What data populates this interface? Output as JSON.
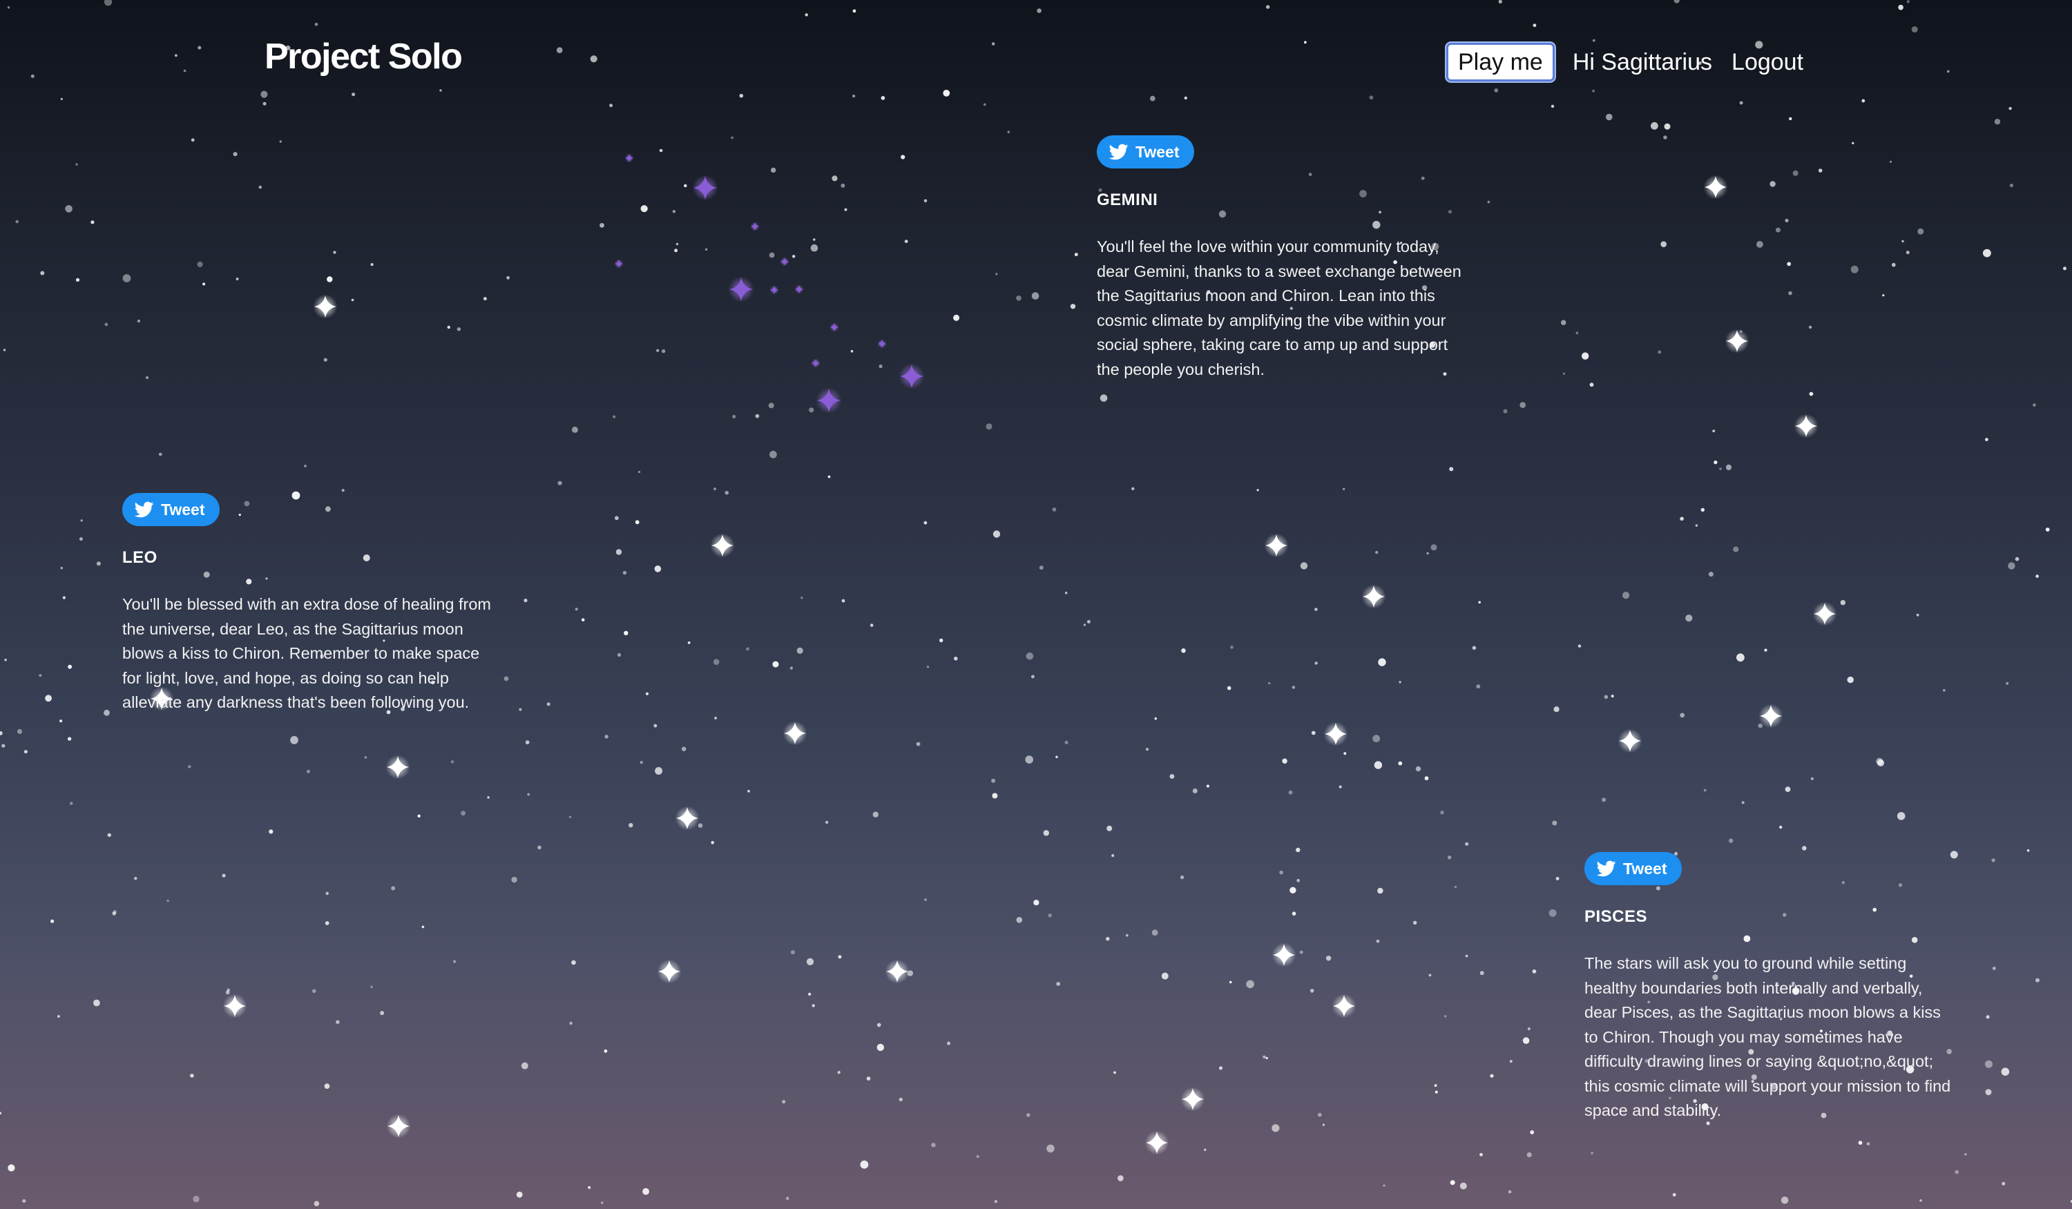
{
  "header": {
    "brand": "Project Solo",
    "play_label": "Play me",
    "greeting": "Hi Sagittarius",
    "logout_label": "Logout"
  },
  "cards": [
    {
      "tweet_label": "Tweet",
      "sign": "GEMINI",
      "text": "You'll feel the love within your community today, dear Gemini, thanks to a sweet exchange between the Sagittarius moon and Chiron. Lean into this cosmic climate by amplifying the vibe within your social sphere, taking care to amp up and support the people you cherish."
    },
    {
      "tweet_label": "Tweet",
      "sign": "LEO",
      "text": "You'll be blessed with an extra dose of healing from the universe, dear Leo, as the Sagittarius moon blows a kiss to Chiron. Remember to make space for light, love, and hope, as doing so can help alleviate any darkness that's been following you."
    },
    {
      "tweet_label": "Tweet",
      "sign": "PISCES",
      "text": "The stars will ask you to ground while setting healthy boundaries both internally and verbally, dear Pisces, as the Sagittarius moon blows a kiss to Chiron. Though you may sometimes have difficulty drawing lines or saying &quot;no,&quot; this cosmic climate will support your mission to find space and stability."
    }
  ],
  "icons": {
    "tweet": "twitter-bird-icon",
    "sparkle": "sparkle-star-icon"
  },
  "colors": {
    "tweet_button": "#1d8ff0",
    "play_button_border": "#5a7fd6",
    "sky_top": "#0f131b",
    "sky_bottom": "#6b5a6d",
    "purple_sparkle": "#8a5cd6"
  }
}
